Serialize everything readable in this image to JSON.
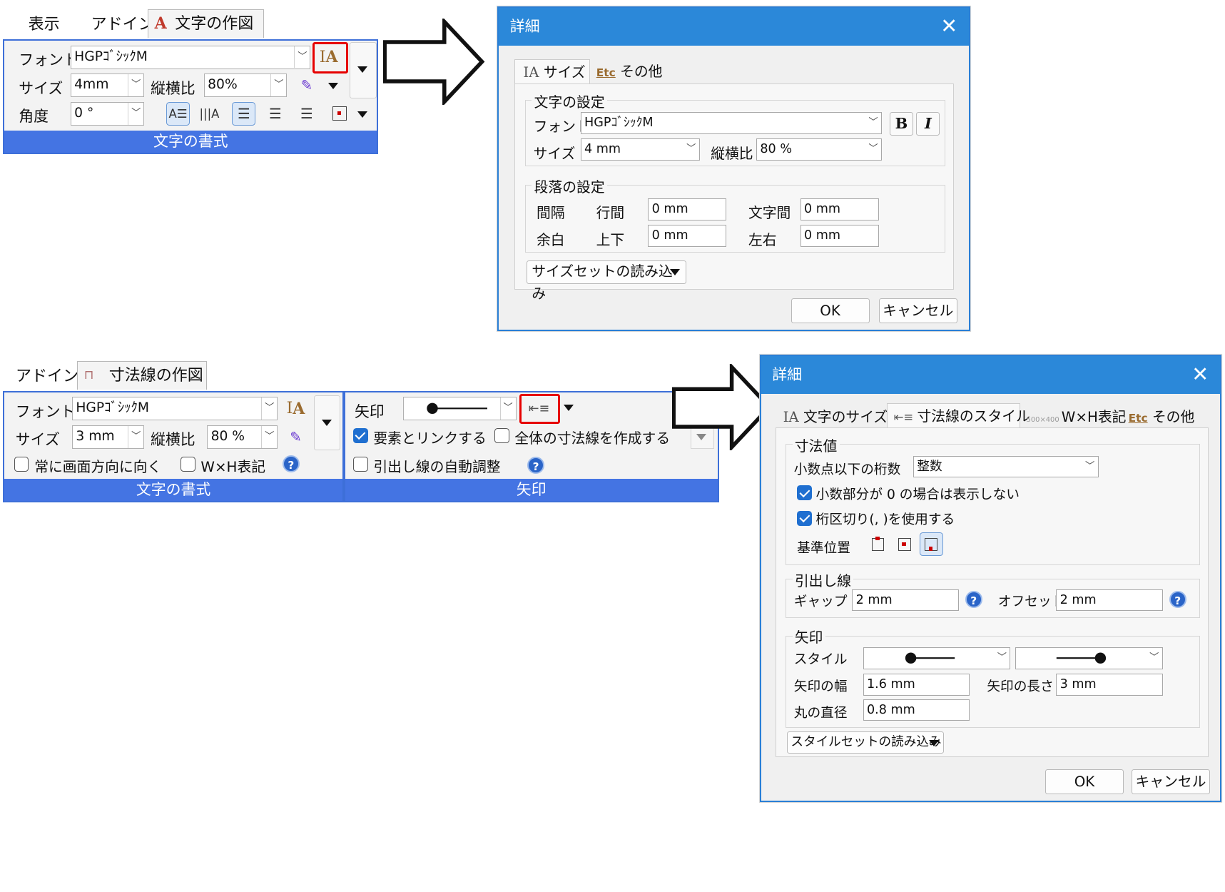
{
  "top_ribbon": {
    "tabs": [
      "表示",
      "アドイン",
      "文字の作図"
    ],
    "font_label": "フォント",
    "font_value": "HGPｺﾞｼｯｸM",
    "size_label": "サイズ",
    "size_value": "4mm",
    "ratio_label": "縦横比",
    "ratio_value": "80%",
    "angle_label": "角度",
    "angle_value": "0 °",
    "group_title": "文字の書式"
  },
  "dialog1": {
    "title": "詳細",
    "tabs": [
      "サイズ",
      "その他"
    ],
    "char_group": "文字の設定",
    "font_label": "フォント",
    "font_value": "HGPｺﾞｼｯｸM",
    "size_label": "サイズ",
    "size_value": "4 mm",
    "ratio_label": "縦横比",
    "ratio_value": "80 %",
    "para_group": "段落の設定",
    "spacing_label": "間隔",
    "line_label": "行間",
    "line_value": "0 mm",
    "charsp_label": "文字間",
    "charsp_value": "0 mm",
    "margin_label": "余白",
    "tb_label": "上下",
    "tb_value": "0 mm",
    "lr_label": "左右",
    "lr_value": "0 mm",
    "load_set": "サイズセットの読み込み",
    "ok": "OK",
    "cancel": "キャンセル"
  },
  "bottom_ribbon": {
    "tabs": [
      "アドイン",
      "寸法線の作図"
    ],
    "font_label": "フォント",
    "font_value": "HGPｺﾞｼｯｸM",
    "size_label": "サイズ",
    "size_value": "3 mm",
    "ratio_label": "縦横比",
    "ratio_value": "80 %",
    "screen_dir": "常に画面方向に向く",
    "wxh": "W×H表記",
    "group_title_left": "文字の書式",
    "arrow_label": "矢印",
    "link_elem": "要素とリンクする",
    "all_dim": "全体の寸法線を作成する",
    "auto_adjust": "引出し線の自動調整",
    "group_title_right": "矢印"
  },
  "dialog2": {
    "title": "詳細",
    "tabs": [
      "文字のサイズ",
      "寸法線のスタイル",
      "W×H表記",
      "その他"
    ],
    "dim_group": "寸法値",
    "decimals_label": "小数点以下の桁数",
    "decimals_value": "整数",
    "hide_zero": "小数部分が 0 の場合は表示しない",
    "thousands": "桁区切り(, )を使用する",
    "base_pos": "基準位置",
    "leader_group": "引出し線",
    "gap_label": "ギャップ",
    "gap_value": "2 mm",
    "offset_label": "オフセット",
    "offset_value": "2 mm",
    "arrow_group": "矢印",
    "style_label": "スタイル",
    "arrow_width_label": "矢印の幅",
    "arrow_width_value": "1.6 mm",
    "arrow_len_label": "矢印の長さ",
    "arrow_len_value": "3 mm",
    "circle_label": "丸の直径",
    "circle_value": "0.8 mm",
    "load_set": "スタイルセットの読み込み",
    "ok": "OK",
    "cancel": "キャンセル"
  },
  "colors": {
    "ribbon_title": "#4474e3",
    "dialog_header": "#2b88d9",
    "highlight": "#e60000",
    "check": "#1f6fd0"
  }
}
